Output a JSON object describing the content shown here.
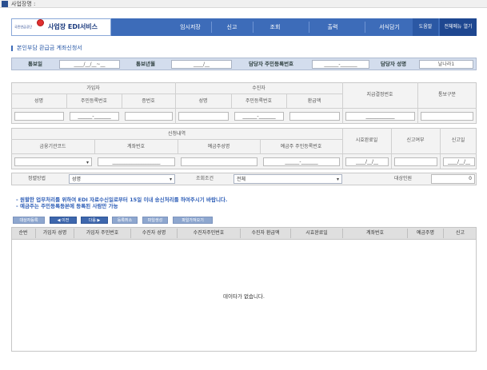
{
  "window": {
    "title": "사업장명 :"
  },
  "header": {
    "logo_small": "국민연금공단",
    "logo_name": "사업장 EDI서비스",
    "nav": [
      "임시저장",
      "신고",
      "조회",
      "출력",
      "서식담기"
    ],
    "help_btn": "도움말",
    "all_menu_btn": "전체메뉴 열기"
  },
  "section": {
    "title": "본인부담 환급금 계좌신청서"
  },
  "info": {
    "notice_date_label": "통보일",
    "notice_date_value": "____/__/__~__",
    "notice_month_label": "통보년월",
    "notice_month_value": "____/__",
    "manager_rrn_label": "담당자 주민등록번호",
    "manager_rrn_value": "______-_______",
    "manager_name_label": "담당자 성명",
    "manager_name_value": "날나라1"
  },
  "block1": {
    "group_subscriber": "가입자",
    "group_recipient": "수진자",
    "sub_cols": [
      "성명",
      "주민등록번호",
      "증번호"
    ],
    "rec_cols": [
      "성명",
      "주민등록번호",
      "환급액"
    ],
    "pay_decision_no": "지급결정번호",
    "notice_type": "통보구분",
    "sub_rrn_value": "______-_______",
    "rec_rrn_value": "______-_______",
    "pay_no_value": "____________"
  },
  "block2": {
    "group_apply": "신청내역",
    "cols": [
      "금융기관코드",
      "계좌번호",
      "예금주성명",
      "예금주 주민등록번호"
    ],
    "request_date": "시효완료일",
    "report_yn": "신고여부",
    "report_date": "신고일",
    "account_value": "____________________",
    "holder_rrn_value": "______-_______",
    "date_value": "____/__/__"
  },
  "filter": {
    "method_label": "정렬방법",
    "method_value": "성명",
    "condition_label": "조회조건",
    "condition_value": "전체",
    "target_label": "대상인원",
    "target_value": "0"
  },
  "notice": {
    "line1": "- 원할한 업무처리를 위하여 EDI 자료수신일로부터 15일 이내 송신처리를 하여주시기 바랍니다.",
    "line2": "- 예금주는 주민등록등본에 등록된 사람만 가능"
  },
  "buttons": {
    "target_register": "대상자등록",
    "prev": "◀ 이전",
    "next": "다음 ▶",
    "cancel_register": "등록취소",
    "file_create": "파일생성",
    "file_import": "파일가져오기"
  },
  "table": {
    "headers": [
      "순번",
      "가입자 성명",
      "가입자 주민번호",
      "수진자 성명",
      "수진자주민번호",
      "수진자 환급액",
      "시효완료일",
      "계좌번호",
      "예금주명",
      "신고"
    ],
    "empty_text": "데이타가 없습니다."
  }
}
